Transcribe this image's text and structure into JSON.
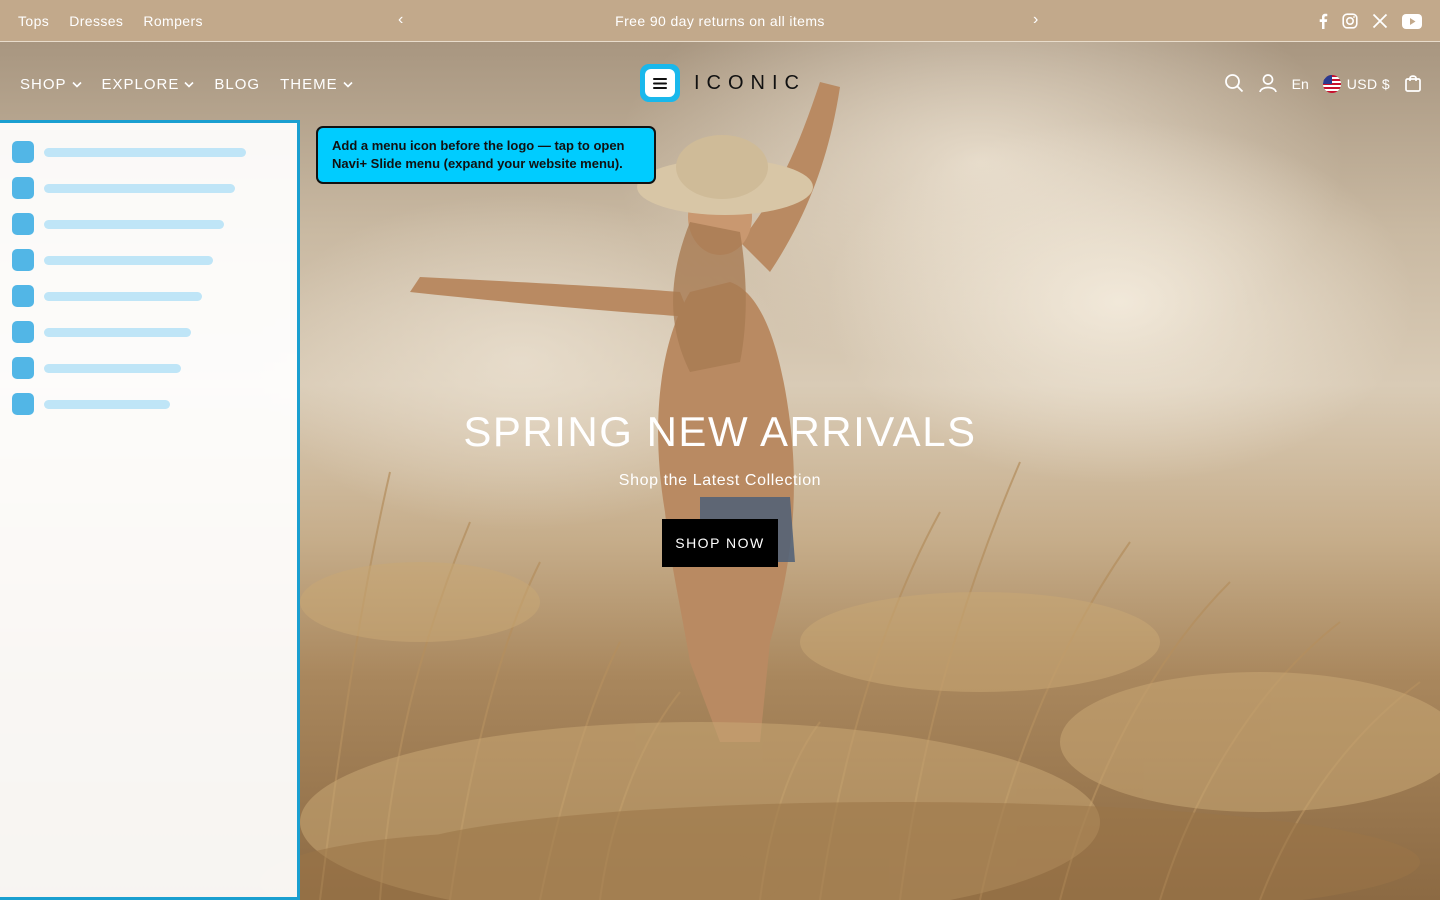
{
  "announcement": {
    "links": [
      "Tops",
      "Dresses",
      "Rompers"
    ],
    "message": "Free 90 day returns on all items",
    "prev_arrow": "‹",
    "next_arrow": "›",
    "socials": [
      "facebook-icon",
      "instagram-icon",
      "x-icon",
      "youtube-icon"
    ]
  },
  "header": {
    "nav": [
      {
        "label": "SHOP",
        "dropdown": true
      },
      {
        "label": "EXPLORE",
        "dropdown": true
      },
      {
        "label": "BLOG",
        "dropdown": false
      },
      {
        "label": "THEME",
        "dropdown": true
      }
    ],
    "logo": "ICONIC",
    "language": "En",
    "currency": "USD $"
  },
  "tooltip": {
    "line1": "Add a menu icon before the logo — tap to open",
    "line2": "Navi+ Slide menu (expand your website menu)."
  },
  "hero": {
    "title": "SPRING NEW ARRIVALS",
    "subtitle": "Shop the Latest Collection",
    "button": "SHOP NOW"
  },
  "colors": {
    "announcement_bg": "#c2a98b",
    "accent": "#19b8ec",
    "tooltip_bg": "#00ccff",
    "panel_border": "#1a9fd0"
  }
}
